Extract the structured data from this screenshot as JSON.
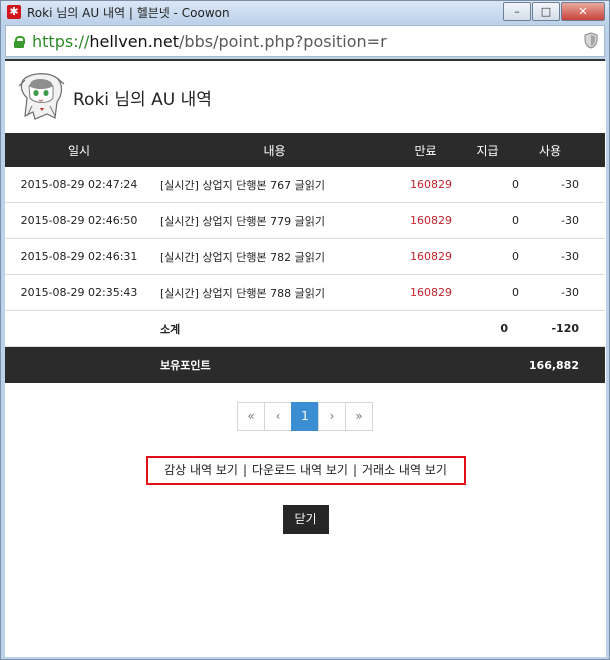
{
  "window": {
    "title": "Roki 님의 AU 내역 | 헬븐넷 - Coowon",
    "controls": [
      "–",
      "□",
      "✕"
    ]
  },
  "addressbar": {
    "scheme": "https://",
    "host": "hellven.net",
    "path": "/bbs/point.php?position=r"
  },
  "page": {
    "title": "Roki 님의 AU 내역"
  },
  "table": {
    "headers": [
      "일시",
      "내용",
      "만료",
      "지급",
      "사용"
    ],
    "rows": [
      {
        "datetime": "2015-08-29 02:47:24",
        "content": "[실시간] 상업지 단행본 767 글읽기",
        "expiry": "160829",
        "given": "0",
        "used": "-30"
      },
      {
        "datetime": "2015-08-29 02:46:50",
        "content": "[실시간] 상업지 단행본 779 글읽기",
        "expiry": "160829",
        "given": "0",
        "used": "-30"
      },
      {
        "datetime": "2015-08-29 02:46:31",
        "content": "[실시간] 상업지 단행본 782 글읽기",
        "expiry": "160829",
        "given": "0",
        "used": "-30"
      },
      {
        "datetime": "2015-08-29 02:35:43",
        "content": "[실시간] 상업지 단행본 788 글읽기",
        "expiry": "160829",
        "given": "0",
        "used": "-30"
      }
    ],
    "subtotal": {
      "label": "소계",
      "given": "0",
      "used": "-120"
    },
    "balance": {
      "label": "보유포인트",
      "value": "166,882"
    }
  },
  "pagination": {
    "first": "«",
    "prev": "‹",
    "current": "1",
    "next": "›",
    "last": "»"
  },
  "links": {
    "view_history": "감상 내역 보기",
    "download_history": "다운로드 내역 보기",
    "exchange_history": "거래소 내역 보기",
    "separator": "|"
  },
  "close_label": "닫기"
}
